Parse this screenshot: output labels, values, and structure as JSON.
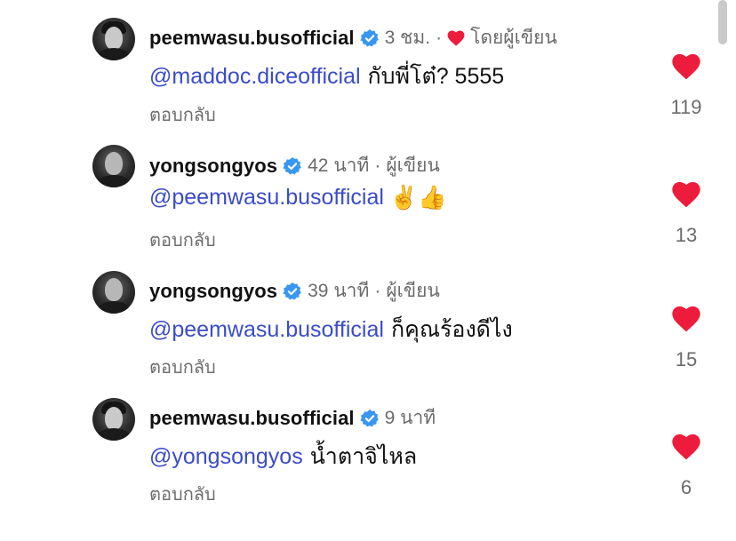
{
  "comments": [
    {
      "username": "peemwasu.busofficial",
      "time": "3 ชม.",
      "meta_label": "โดยผู้เขียน",
      "meta_is_liked_by_author": true,
      "mention": "@maddoc.diceofficial",
      "text": "กับพี่โต๋? 5555",
      "emoji": "",
      "reply_label": "ตอบกลับ",
      "likes": "119",
      "avatar_style": "hair"
    },
    {
      "username": "yongsongyos",
      "time": "42 นาที",
      "meta_label": "ผู้เขียน",
      "meta_is_liked_by_author": false,
      "mention": "@peemwasu.busofficial",
      "text": "",
      "emoji": "✌️👍",
      "reply_label": "ตอบกลับ",
      "likes": "13",
      "avatar_style": "bald"
    },
    {
      "username": "yongsongyos",
      "time": "39 นาที",
      "meta_label": "ผู้เขียน",
      "meta_is_liked_by_author": false,
      "mention": "@peemwasu.busofficial",
      "text": "ก็คุณร้องดีไง",
      "emoji": "",
      "reply_label": "ตอบกลับ",
      "likes": "15",
      "avatar_style": "bald"
    },
    {
      "username": "peemwasu.busofficial",
      "time": "9 นาที",
      "meta_label": "",
      "meta_is_liked_by_author": false,
      "mention": "@yongsongyos",
      "text": "น้ำตาจิไหล",
      "emoji": "",
      "reply_label": "ตอบกลับ",
      "likes": "6",
      "avatar_style": "hair"
    }
  ],
  "colors": {
    "mention": "#3b4cca",
    "heart": "#ed1c3c",
    "verified": "#3897f0",
    "meta": "#6b6b6b"
  },
  "icons": {
    "verified": "verified-badge-icon",
    "like": "heart-icon",
    "author_liked": "heart-filled-icon"
  }
}
